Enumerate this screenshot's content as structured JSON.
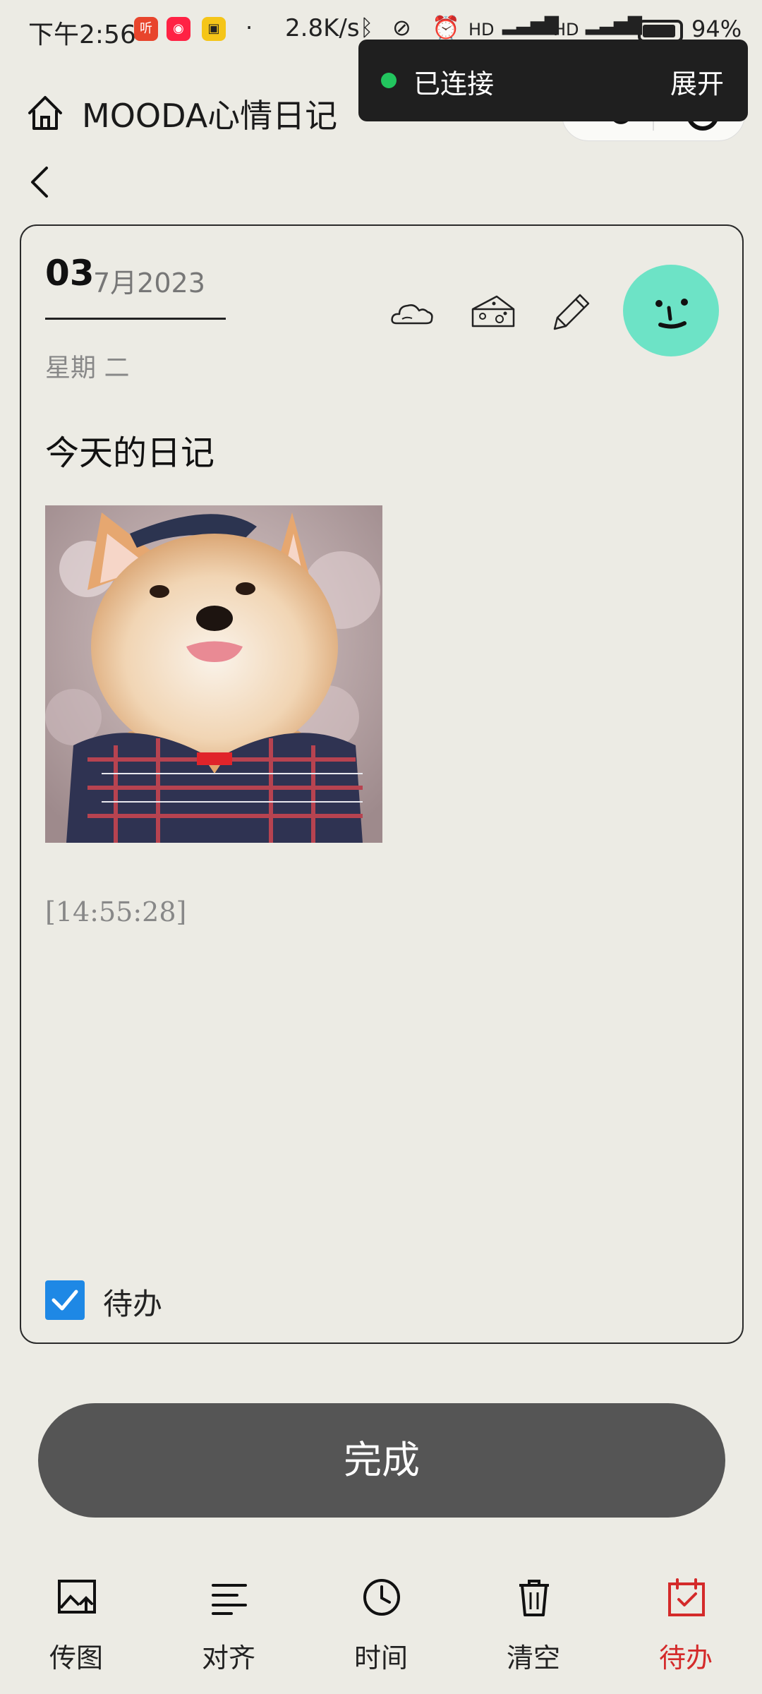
{
  "status_bar": {
    "time": "下午2:56",
    "net_speed": "2.8K/s",
    "battery": "94%"
  },
  "toast": {
    "status": "已连接",
    "expand": "展开"
  },
  "header": {
    "title": "MOODA心情日记"
  },
  "entry": {
    "day": "03",
    "month_year": "7月2023",
    "weekday": "星期 二",
    "title": "今天的日记",
    "timestamp": "[14:55:28]",
    "todo_label": "待办",
    "todo_checked": true
  },
  "mood_color": "#6de3c6",
  "done_button": "完成",
  "toolbar": [
    {
      "label": "传图",
      "icon": "image-upload-icon"
    },
    {
      "label": "对齐",
      "icon": "align-left-icon"
    },
    {
      "label": "时间",
      "icon": "clock-icon"
    },
    {
      "label": "清空",
      "icon": "trash-icon"
    },
    {
      "label": "待办",
      "icon": "calendar-check-icon",
      "active": true
    }
  ],
  "colors": {
    "background": "#ecebe4",
    "accent_red": "#d42a2a",
    "checkbox_blue": "#1e88e5",
    "done_button": "#555555"
  }
}
